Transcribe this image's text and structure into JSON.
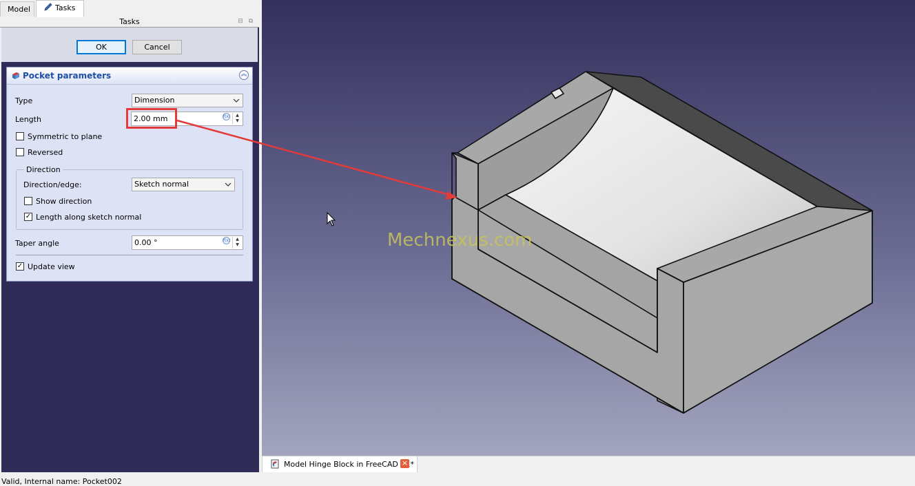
{
  "tabs": {
    "model": "Model",
    "tasks": "Tasks"
  },
  "tasks_header": "Tasks",
  "buttons": {
    "ok": "OK",
    "cancel": "Cancel"
  },
  "panel": {
    "title": "Pocket parameters",
    "type_label": "Type",
    "type_value": "Dimension",
    "length_label": "Length",
    "length_value": "2.00 mm",
    "symmetric_label": "Symmetric to plane",
    "symmetric_checked": false,
    "reversed_label": "Reversed",
    "reversed_checked": false,
    "direction_group": "Direction",
    "direction_edge_label": "Direction/edge:",
    "direction_edge_value": "Sketch normal",
    "show_direction_label": "Show direction",
    "show_direction_checked": false,
    "along_normal_label": "Length along sketch normal",
    "along_normal_checked": true,
    "taper_label": "Taper angle",
    "taper_value": "0.00 °",
    "update_view_label": "Update view",
    "update_view_checked": true
  },
  "viewport": {
    "watermark": "Mechnexus.com"
  },
  "document_tab": {
    "label": "Model Hinge Block in FreeCAD : 1*"
  },
  "status": "Valid, Internal name: Pocket002",
  "icons": [
    "pencil-icon",
    "pocket-icon",
    "collapse-icon",
    "dropdown-arrow-icon",
    "expression-icon",
    "spin-up-icon",
    "spin-down-icon",
    "checkmark-icon",
    "mouse-cursor-icon",
    "document-icon",
    "close-icon"
  ],
  "colors": {
    "highlight": "#e33a3a",
    "panel_title": "#1f4ea5",
    "viewport_top": "#33305c",
    "viewport_bottom": "#a3a5be"
  }
}
